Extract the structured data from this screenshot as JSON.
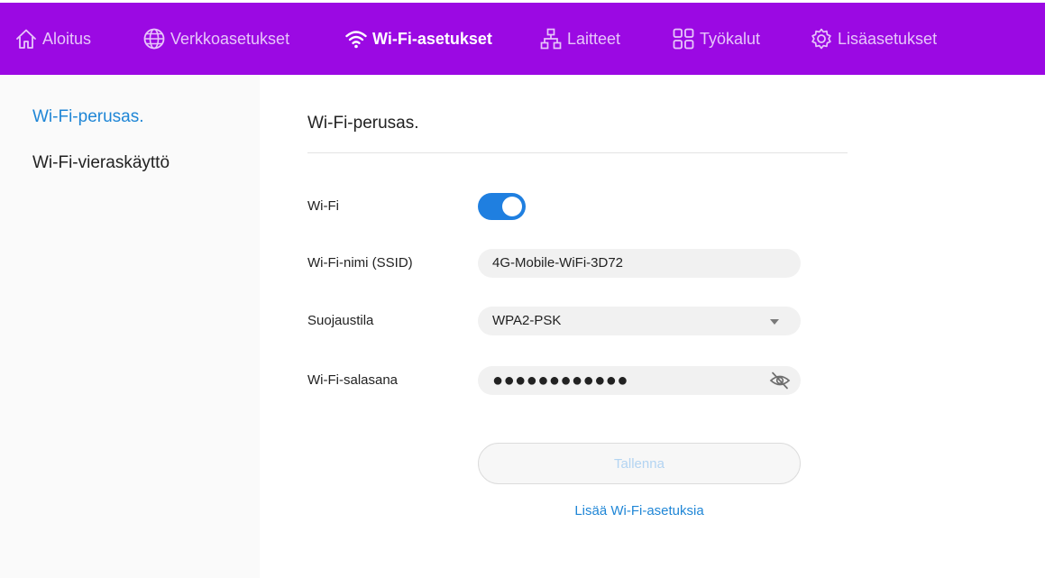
{
  "nav": {
    "items": [
      {
        "label": "Aloitus",
        "icon": "home-icon"
      },
      {
        "label": "Verkkoasetukset",
        "icon": "globe-icon"
      },
      {
        "label": "Wi-Fi-asetukset",
        "icon": "wifi-icon",
        "active": true
      },
      {
        "label": "Laitteet",
        "icon": "devices-icon"
      },
      {
        "label": "Työkalut",
        "icon": "tools-icon"
      },
      {
        "label": "Lisäasetukset",
        "icon": "gear-icon"
      }
    ]
  },
  "sidebar": {
    "items": [
      {
        "label": "Wi-Fi-perusas.",
        "active": true
      },
      {
        "label": "Wi-Fi-vieraskäyttö"
      }
    ]
  },
  "main": {
    "title": "Wi-Fi-perusas.",
    "wifi": {
      "label": "Wi-Fi",
      "enabled": true
    },
    "ssid": {
      "label": "Wi-Fi-nimi (SSID)",
      "value": "4G-Mobile-WiFi-3D72"
    },
    "security": {
      "label": "Suojaustila",
      "value": "WPA2-PSK"
    },
    "password": {
      "label": "Wi-Fi-salasana",
      "value": "●●●●●●●●●●●●"
    },
    "save_label": "Tallenna",
    "more_link": "Lisää Wi-Fi-asetuksia"
  },
  "colors": {
    "nav_bg": "#9b09e3",
    "nav_text": "#e7c6fa",
    "accent_blue": "#1f7fe0",
    "link_blue": "#1f86d6",
    "field_bg": "#f1f1f1"
  }
}
